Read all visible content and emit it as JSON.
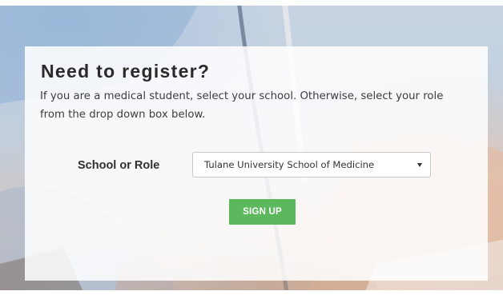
{
  "register": {
    "title": "Need to register?",
    "description": "If you are a medical student, select your school. Otherwise, select your role from the drop down box below.",
    "field_label": "School or Role",
    "select_value": "Tulane University School of Medicine",
    "submit_label": "SIGN UP"
  },
  "icons": {
    "dropdown": "caret-down-icon"
  },
  "colors": {
    "button": "#5cb85c",
    "button_text": "#ffffff",
    "title_text": "#2a2a2a",
    "card_background": "rgba(255,255,255,0.86)"
  }
}
